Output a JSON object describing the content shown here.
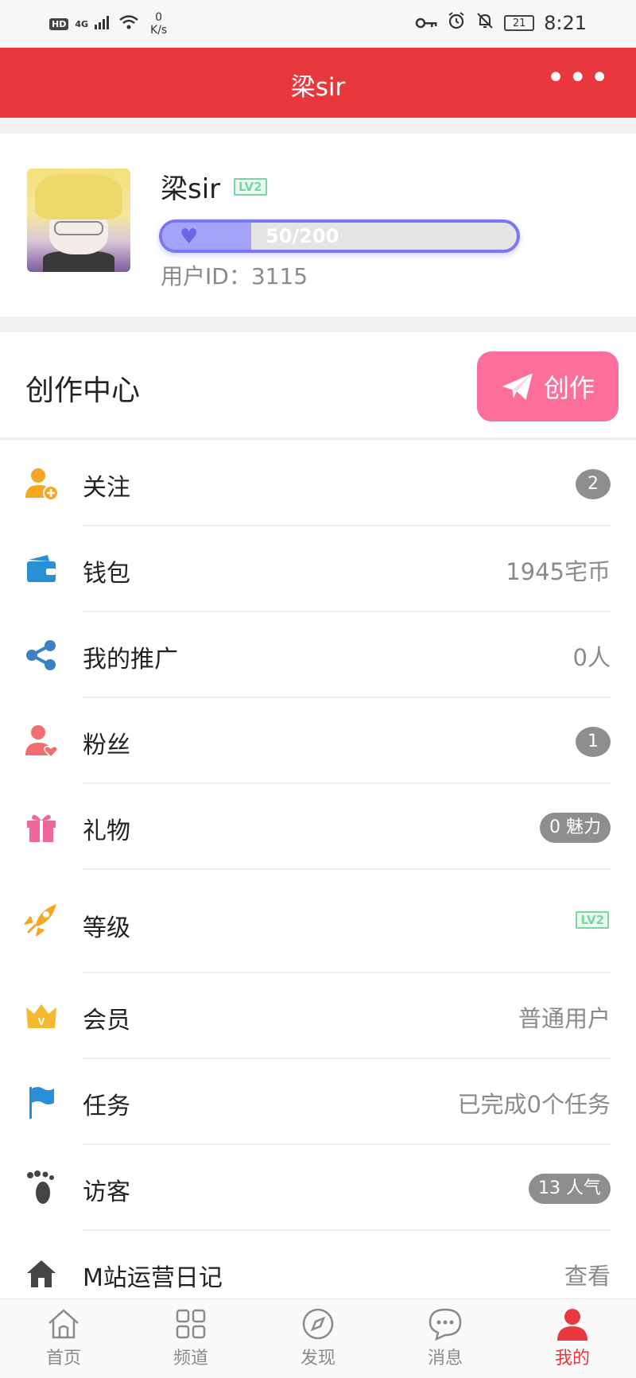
{
  "status_bar": {
    "hd": "HD",
    "network": "4G",
    "speed_value": "0",
    "speed_unit": "K/s",
    "battery": "21",
    "time": "8:21"
  },
  "header": {
    "title": "梁sir",
    "more": "•••"
  },
  "profile": {
    "name": "梁sir",
    "level_badge": "LV2",
    "exp_text": "50/200",
    "exp_fraction": 0.25,
    "user_id": "用户ID：3115"
  },
  "create": {
    "title": "创作中心",
    "button_label": "创作"
  },
  "menu": [
    {
      "label": "关注",
      "value": "2",
      "icon": "user-plus-icon",
      "color": "#f5a623"
    },
    {
      "label": "钱包",
      "value": "1945宅币",
      "icon": "wallet-icon",
      "color": "#2b8fd6"
    },
    {
      "label": "我的推广",
      "value": "0人",
      "icon": "share-icon",
      "color": "#3b7fc4"
    },
    {
      "label": "粉丝",
      "value": "1",
      "icon": "fans-icon",
      "color": "#ef6f6f"
    },
    {
      "label": "礼物",
      "value": "0 魅力",
      "icon": "gift-icon",
      "color": "#f0679a"
    },
    {
      "label": "等级",
      "value": "LV2",
      "icon": "rocket-icon",
      "color": "#f5a623"
    },
    {
      "label": "会员",
      "value": "普通用户",
      "icon": "crown-icon",
      "color": "#f5b82e"
    },
    {
      "label": "任务",
      "value": "已完成0个任务",
      "icon": "flag-icon",
      "color": "#2b8fd6"
    },
    {
      "label": "访客",
      "value": "13 人气",
      "icon": "footprint-icon",
      "color": "#444444"
    },
    {
      "label": "M站运营日记",
      "value": "查看",
      "icon": "home-icon",
      "color": "#444444"
    }
  ],
  "tabs": [
    {
      "label": "首页",
      "icon": "home-tab-icon"
    },
    {
      "label": "频道",
      "icon": "grid-icon"
    },
    {
      "label": "发现",
      "icon": "compass-icon"
    },
    {
      "label": "消息",
      "icon": "message-icon"
    },
    {
      "label": "我的",
      "icon": "profile-icon",
      "active": true
    }
  ],
  "colors": {
    "brand_red": "#e8383d",
    "create_pink": "#fb6f9a",
    "exp_border": "#7a77f2",
    "level_green": "#7ad6a4"
  }
}
